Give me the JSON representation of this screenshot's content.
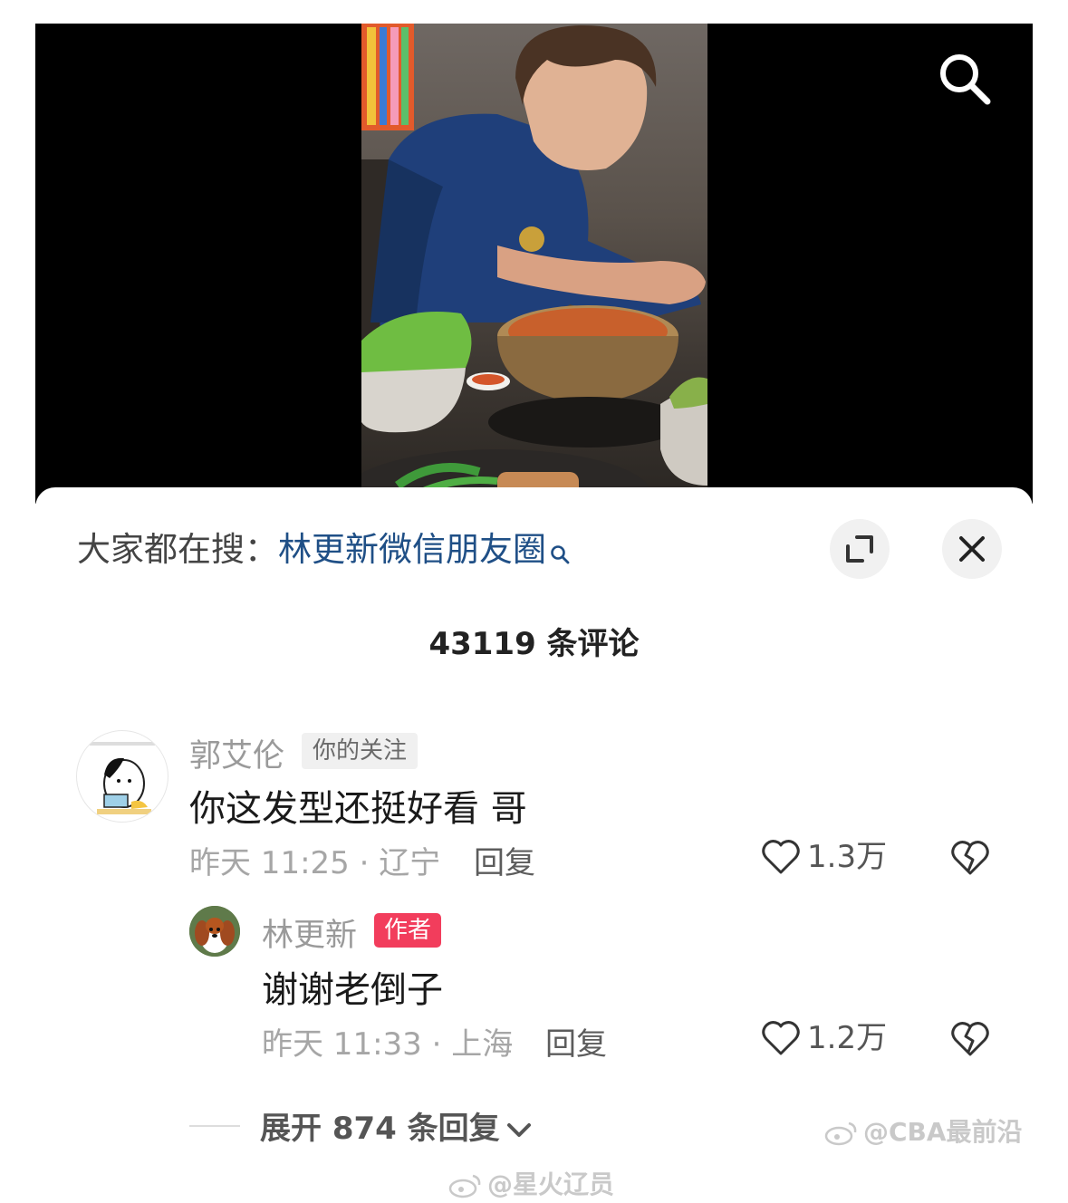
{
  "video": {
    "search_icon": "search-icon"
  },
  "hot_search": {
    "prefix": "大家都在搜：",
    "query": "林更新微信朋友圈",
    "icon": "search-small-icon",
    "link_color": "#1f4f86"
  },
  "header": {
    "expand_icon": "expand-icon",
    "close_icon": "close-icon",
    "comment_count": "43119 条评论"
  },
  "comments": [
    {
      "username": "郭艾伦",
      "badge": "你的关注",
      "text": "你这发型还挺好看 哥",
      "time_location": "昨天 11:25 · 辽宁",
      "reply_label": "回复",
      "likes": "1.3万"
    }
  ],
  "reply": {
    "username": "林更新",
    "badge": "作者",
    "badge_color": "#f23d5c",
    "text": "谢谢老倒子",
    "time_location": "昨天 11:33 · 上海",
    "reply_label": "回复",
    "likes": "1.2万"
  },
  "expand_replies": {
    "label": "展开 874 条回复"
  },
  "watermarks": {
    "right": "@CBA最前沿",
    "bottom": "@星火辽员"
  }
}
